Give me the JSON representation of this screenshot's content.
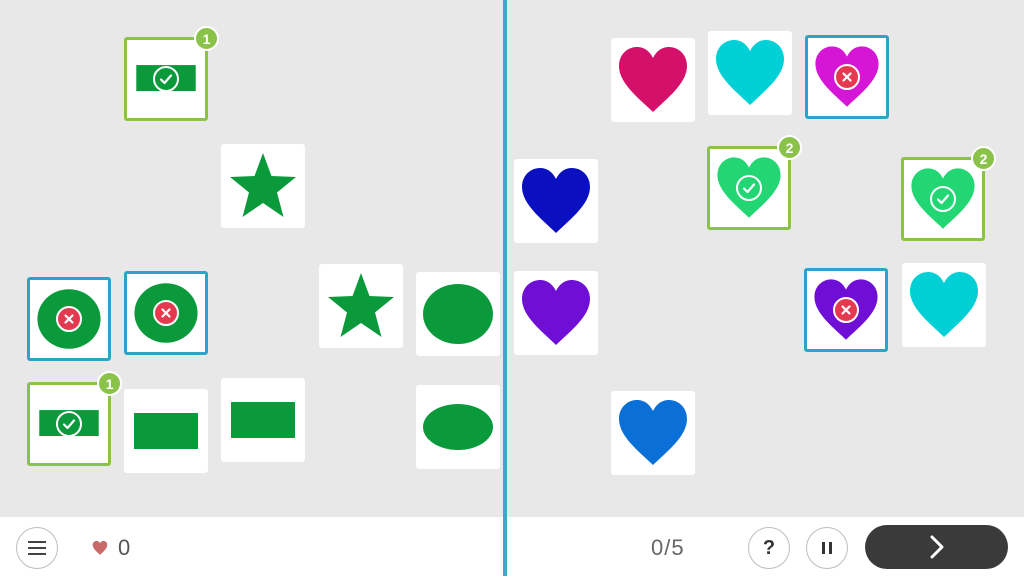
{
  "footer": {
    "lives_count": "0",
    "progress": "0/5",
    "help_label": "?"
  },
  "colors": {
    "green_shape": "#0b9a3b",
    "correct_border": "#8bc34a",
    "wrong_border": "#2ea3c7",
    "divider": "#3fa7c9",
    "heart_magenta": "#d4106a",
    "heart_cyan": "#00d0d6",
    "heart_pink": "#d616d6",
    "heart_mint": "#22d673",
    "heart_navy": "#0a10c0",
    "heart_purple": "#6f0fd6",
    "heart_blue": "#0a6fd6"
  },
  "left_cards": [
    {
      "shape": "rectangle",
      "color": "#0b9a3b",
      "state": "correct",
      "badge": "1"
    },
    {
      "shape": "star",
      "color": "#0b9a3b",
      "state": "none"
    },
    {
      "shape": "circle",
      "color": "#0b9a3b",
      "state": "wrong"
    },
    {
      "shape": "circle",
      "color": "#0b9a3b",
      "state": "wrong"
    },
    {
      "shape": "star",
      "color": "#0b9a3b",
      "state": "none"
    },
    {
      "shape": "ellipse",
      "color": "#0b9a3b",
      "state": "none"
    },
    {
      "shape": "rectangle",
      "color": "#0b9a3b",
      "state": "correct",
      "badge": "1"
    },
    {
      "shape": "rectangle",
      "color": "#0b9a3b",
      "state": "none"
    },
    {
      "shape": "rectangle",
      "color": "#0b9a3b",
      "state": "none"
    },
    {
      "shape": "ellipse",
      "color": "#0b9a3b",
      "state": "none"
    }
  ],
  "right_cards": [
    {
      "shape": "heart",
      "color": "#d4106a",
      "state": "none"
    },
    {
      "shape": "heart",
      "color": "#00d0d6",
      "state": "none"
    },
    {
      "shape": "heart",
      "color": "#d616d6",
      "state": "wrong"
    },
    {
      "shape": "heart",
      "color": "#0a10c0",
      "state": "none"
    },
    {
      "shape": "heart",
      "color": "#22d673",
      "state": "correct",
      "badge": "2"
    },
    {
      "shape": "heart",
      "color": "#22d673",
      "state": "correct",
      "badge": "2"
    },
    {
      "shape": "heart",
      "color": "#6f0fd6",
      "state": "none"
    },
    {
      "shape": "heart",
      "color": "#6f0fd6",
      "state": "wrong"
    },
    {
      "shape": "heart",
      "color": "#00d0d6",
      "state": "none"
    },
    {
      "shape": "heart",
      "color": "#0a6fd6",
      "state": "none"
    }
  ]
}
